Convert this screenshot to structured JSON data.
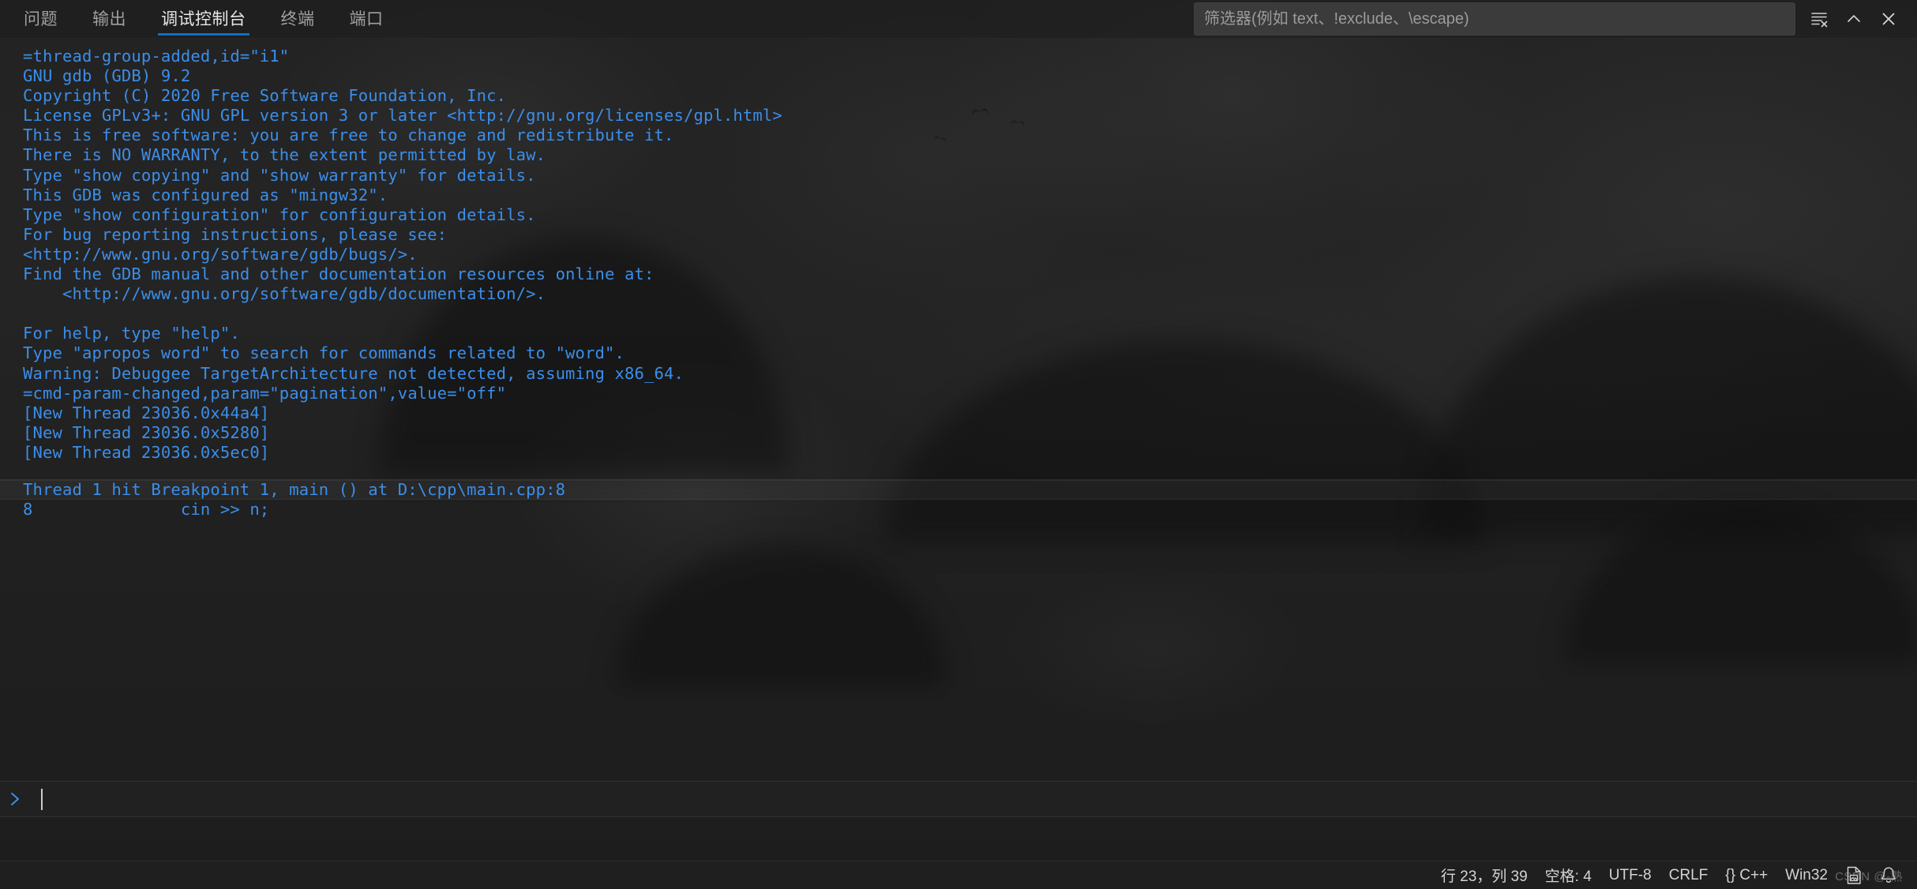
{
  "theme": {
    "accent": "#0e70c0",
    "console_text": "#3b8eea",
    "panel_bg": "#1e1e1e",
    "statusbar_bg": "#202020",
    "tab_inactive": "#a0a0a0",
    "tab_active": "#e7e7e7"
  },
  "panel": {
    "tabs": [
      {
        "label": "问题",
        "active": false
      },
      {
        "label": "输出",
        "active": false
      },
      {
        "label": "调试控制台",
        "active": true
      },
      {
        "label": "终端",
        "active": false
      },
      {
        "label": "端口",
        "active": false
      }
    ],
    "filter": {
      "value": "",
      "placeholder": "筛选器(例如 text、!exclude、\\escape)"
    },
    "actions": [
      {
        "icon": "clear-console-icon",
        "title": "清除控制台"
      },
      {
        "icon": "chevron-up-icon",
        "title": "最大化面板大小"
      },
      {
        "icon": "close-icon",
        "title": "关闭面板"
      }
    ]
  },
  "console": {
    "lines": [
      {
        "text": "=thread-group-added,id=\"i1\""
      },
      {
        "text": "GNU gdb (GDB) 9.2"
      },
      {
        "text": "Copyright (C) 2020 Free Software Foundation, Inc."
      },
      {
        "text": "License GPLv3+: GNU GPL version 3 or later <http://gnu.org/licenses/gpl.html>"
      },
      {
        "text": "This is free software: you are free to change and redistribute it."
      },
      {
        "text": "There is NO WARRANTY, to the extent permitted by law."
      },
      {
        "text": "Type \"show copying\" and \"show warranty\" for details."
      },
      {
        "text": "This GDB was configured as \"mingw32\"."
      },
      {
        "text": "Type \"show configuration\" for configuration details."
      },
      {
        "text": "For bug reporting instructions, please see:"
      },
      {
        "text": "<http://www.gnu.org/software/gdb/bugs/>."
      },
      {
        "text": "Find the GDB manual and other documentation resources online at:"
      },
      {
        "text": "    <http://www.gnu.org/software/gdb/documentation/>."
      },
      {
        "text": ""
      },
      {
        "text": "For help, type \"help\"."
      },
      {
        "text": "Type \"apropos word\" to search for commands related to \"word\"."
      },
      {
        "text": "Warning: Debuggee TargetArchitecture not detected, assuming x86_64."
      },
      {
        "text": "=cmd-param-changed,param=\"pagination\",value=\"off\""
      },
      {
        "text": "[New Thread 23036.0x44a4]"
      },
      {
        "text": "[New Thread 23036.0x5280]"
      },
      {
        "text": "[New Thread 23036.0x5ec0]"
      }
    ],
    "group": [
      {
        "text": "Thread 1 hit Breakpoint 1, main () at D:\\cpp\\main.cpp:8",
        "highlight": true
      },
      {
        "text": "8               cin >> n;",
        "highlight": false
      }
    ]
  },
  "repl": {
    "prompt": ">",
    "value": ""
  },
  "statusbar": {
    "items": [
      {
        "name": "editor-position",
        "label": "行 23，列 39"
      },
      {
        "name": "indentation",
        "label": "空格: 4"
      },
      {
        "name": "encoding",
        "label": "UTF-8"
      },
      {
        "name": "eol",
        "label": "CRLF"
      },
      {
        "name": "language-mode",
        "label": "{} C++"
      },
      {
        "name": "platform",
        "label": "Win32"
      },
      {
        "name": "screenshot-icon",
        "label": ""
      },
      {
        "name": "notifications-bell",
        "label": ""
      }
    ]
  },
  "watermark": {
    "text": "CSDN @-熟"
  }
}
